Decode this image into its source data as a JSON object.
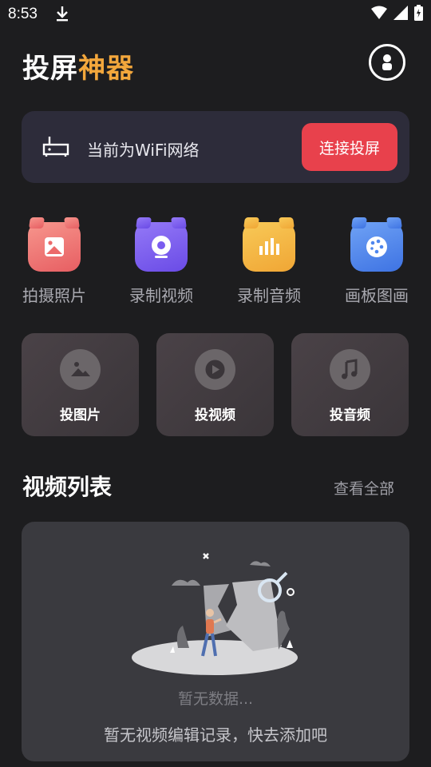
{
  "status_bar": {
    "time": "8:53"
  },
  "header": {
    "title_part1": "投屏",
    "title_part2": "神器",
    "accent_color": "#f3a73c"
  },
  "wifi_card": {
    "status_text": "当前为WiFi网络",
    "connect_label": "连接投屏",
    "button_color": "#e8414c"
  },
  "features": [
    {
      "label": "拍摄照片",
      "icon": "photo-icon",
      "color": "#f06e6e"
    },
    {
      "label": "录制视频",
      "icon": "camera-icon",
      "color": "#7a5cf0"
    },
    {
      "label": "录制音频",
      "icon": "bar-chart-icon",
      "color": "#f3b53c"
    },
    {
      "label": "画板图画",
      "icon": "palette-icon",
      "color": "#4e86ee"
    }
  ],
  "cast_tiles": [
    {
      "label": "投图片",
      "icon": "image-icon"
    },
    {
      "label": "投视频",
      "icon": "play-icon"
    },
    {
      "label": "投音频",
      "icon": "music-icon"
    }
  ],
  "video_section": {
    "title": "视频列表",
    "view_all": "查看全部",
    "view_all_chevron": "›",
    "empty_text": "暂无数据...",
    "empty_hint": "暂无视频编辑记录，快去添加吧"
  }
}
